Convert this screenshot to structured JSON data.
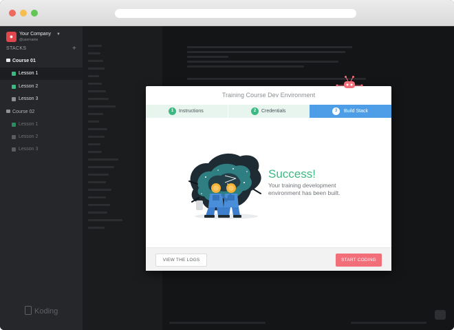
{
  "sidebar": {
    "team_name": "Your Company",
    "team_user": "@username",
    "stacks_label": "STACKS",
    "add_icon": "+",
    "courses": [
      {
        "label": "Course 01",
        "lessons": [
          {
            "label": "Lesson 1",
            "state": "active"
          },
          {
            "label": "Lesson 2",
            "state": "normal"
          },
          {
            "label": "Lesson 3",
            "state": "normal"
          }
        ]
      },
      {
        "label": "Course 02",
        "lessons": [
          {
            "label": "Lesson 1",
            "state": "dim"
          },
          {
            "label": "Lesson 2",
            "state": "dim"
          },
          {
            "label": "Lesson 3",
            "state": "dim"
          }
        ]
      }
    ],
    "brand": "Koding"
  },
  "modal": {
    "title": "Training Course Dev Environment",
    "steps": [
      {
        "num": "1",
        "label": "Instructions",
        "state": "done"
      },
      {
        "num": "2",
        "label": "Credentials",
        "state": "done"
      },
      {
        "num": "3",
        "label": "Build Stack",
        "state": "active"
      }
    ],
    "success_title": "Success!",
    "success_message": "Your training development environment has been built.",
    "logs_button": "VIEW THE LOGS",
    "start_button": "START CODING"
  },
  "colors": {
    "accent_green": "#3db883",
    "accent_blue": "#4d9ee6",
    "accent_pink": "#f26f7a",
    "sidebar_bg": "#26272b"
  },
  "icons": {
    "stacks_add": "plus-icon",
    "course": "stack-icon",
    "lesson": "square-icon",
    "brand": "koding-logo"
  }
}
